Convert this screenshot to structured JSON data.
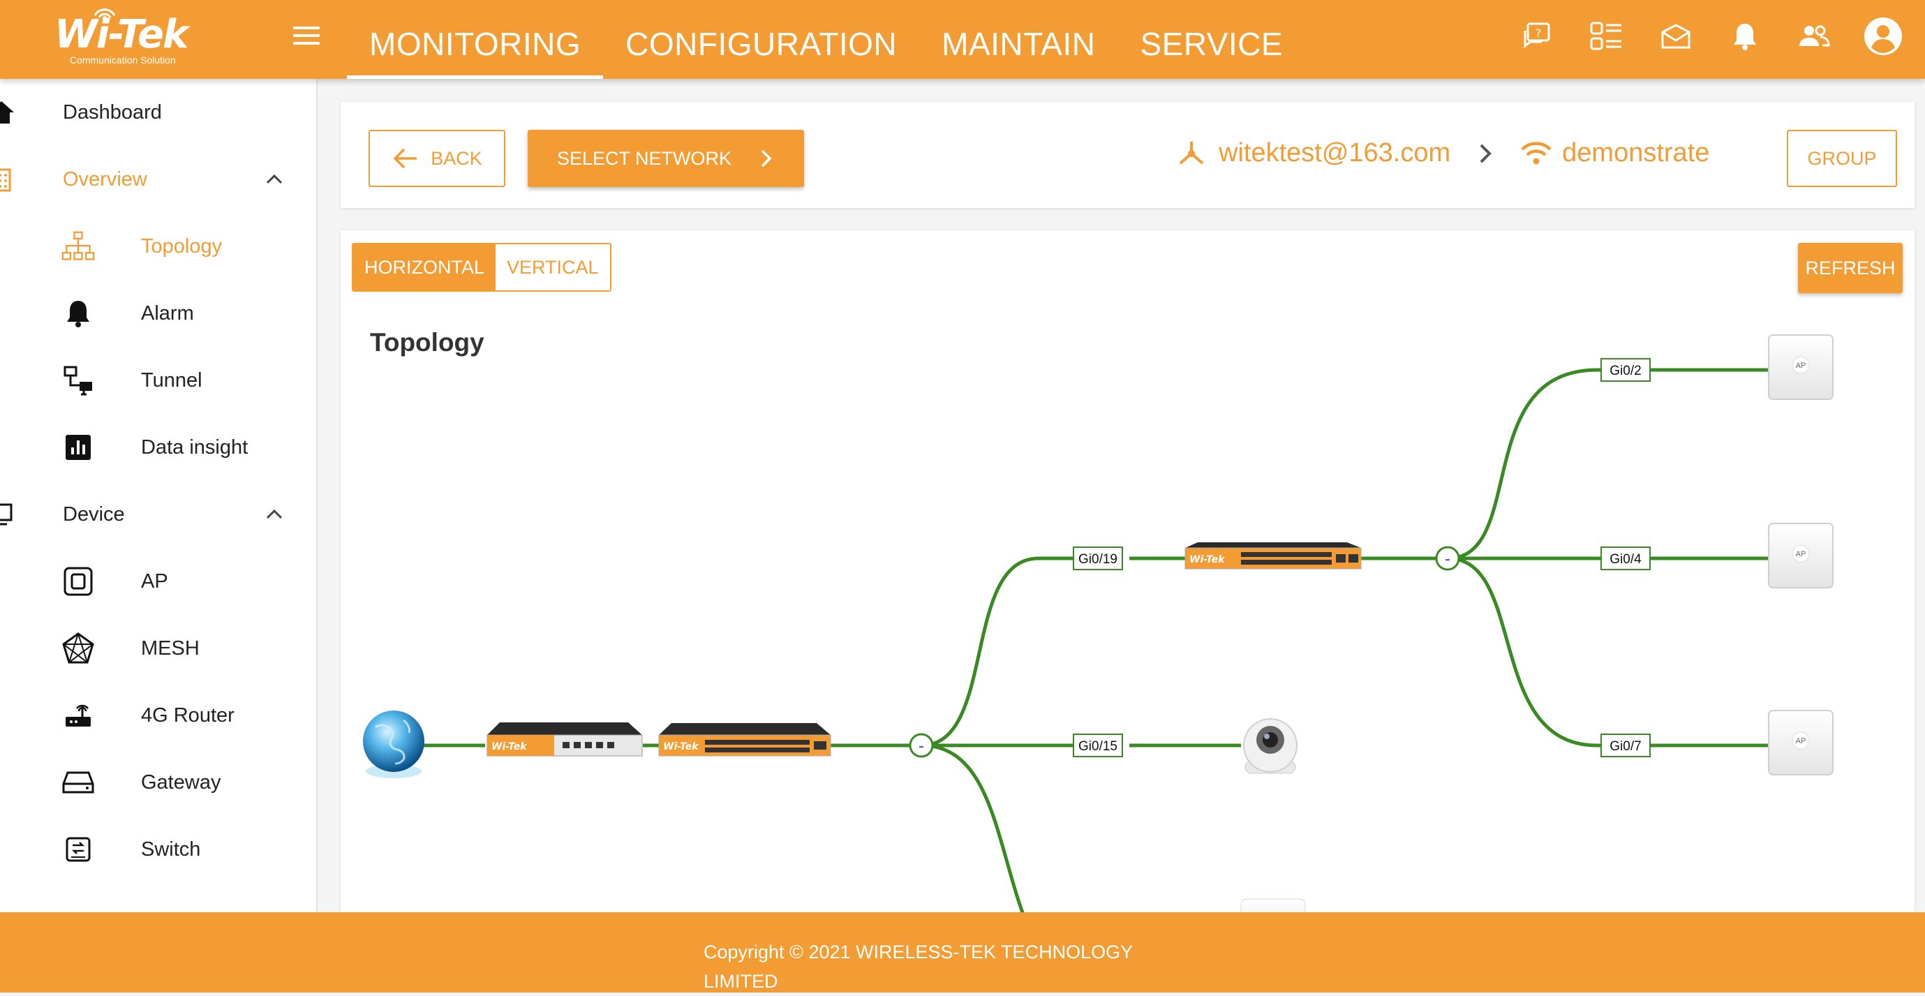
{
  "brand": {
    "logo_text": "Wi-Tek",
    "tagline": "Communication Solution"
  },
  "main_nav": [
    {
      "label": "MONITORING",
      "active": true
    },
    {
      "label": "CONFIGURATION",
      "active": false
    },
    {
      "label": "MAINTAIN",
      "active": false
    },
    {
      "label": "SERVICE",
      "active": false
    }
  ],
  "top_icons": [
    "help-chat-icon",
    "list-view-icon",
    "mail-icon",
    "bell-icon",
    "users-icon",
    "account-icon"
  ],
  "sidebar": {
    "dashboard": "Dashboard",
    "overview": {
      "label": "Overview",
      "items": [
        {
          "label": "Topology",
          "icon": "topology-icon",
          "active": true
        },
        {
          "label": "Alarm",
          "icon": "bell-icon"
        },
        {
          "label": "Tunnel",
          "icon": "tunnel-icon"
        },
        {
          "label": "Data insight",
          "icon": "bar-chart-icon"
        }
      ]
    },
    "device": {
      "label": "Device",
      "items": [
        {
          "label": "AP",
          "icon": "ap-icon"
        },
        {
          "label": "MESH",
          "icon": "mesh-icon"
        },
        {
          "label": "4G Router",
          "icon": "router-icon"
        },
        {
          "label": "Gateway",
          "icon": "gateway-icon"
        },
        {
          "label": "Switch",
          "icon": "switch-icon"
        }
      ]
    }
  },
  "header": {
    "back_label": "BACK",
    "select_network_label": "SELECT NETWORK",
    "account": "witektest@163.com",
    "network": "demonstrate",
    "group_label": "GROUP"
  },
  "topology": {
    "title": "Topology",
    "layout_options": [
      "HORIZONTAL",
      "VERTICAL"
    ],
    "selected_layout": "HORIZONTAL",
    "refresh_label": "REFRESH",
    "port_labels": [
      "Gi0/19",
      "Gi0/15",
      "Gi0/2",
      "Gi0/4",
      "Gi0/7"
    ],
    "device_badge": "AP",
    "collapse_symbol": "-",
    "switch_brand": "Wi-Tek",
    "link_color": "#3a8a24",
    "accent_color": "#f39c34"
  },
  "footer": {
    "copyright": "Copyright © 2021 WIRELESS-TEK TECHNOLOGY LIMITED"
  }
}
